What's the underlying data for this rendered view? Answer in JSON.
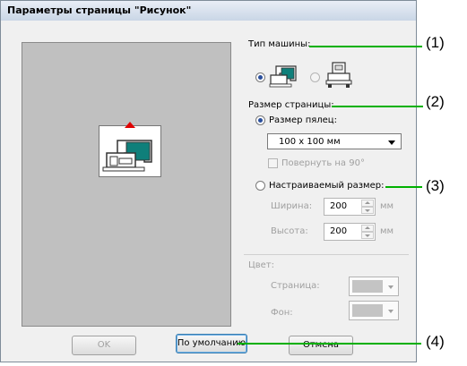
{
  "dialog": {
    "title": "Параметры страницы \"Рисунок\""
  },
  "machine": {
    "label": "Тип машины:"
  },
  "page_size": {
    "label": "Размер страницы:",
    "hoop_label": "Размер пялец:",
    "hoop_value": "100 x 100 мм",
    "rotate_label": "Повернуть на 90°",
    "custom_label": "Настраиваемый размер:",
    "width_label": "Ширина:",
    "width_value": "200",
    "height_label": "Высота:",
    "height_value": "200",
    "unit": "мм"
  },
  "color": {
    "label": "Цвет:",
    "page_label": "Страница:",
    "bg_label": "Фон:"
  },
  "buttons": {
    "ok": "OK",
    "default": "По умолчанию",
    "cancel": "Отмена"
  },
  "callouts": [
    "(1)",
    "(2)",
    "(3)",
    "(4)"
  ],
  "colors": {
    "accent": "#2a4f9c",
    "callout_line": "#00b000",
    "hoop_marker": "#e00000"
  }
}
